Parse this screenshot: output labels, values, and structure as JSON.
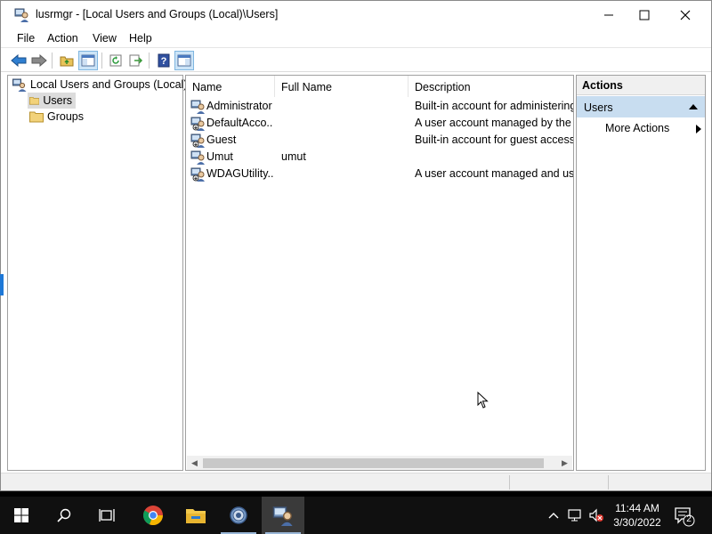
{
  "window": {
    "title": "lusrmgr - [Local Users and Groups (Local)\\Users]",
    "controls": {
      "minimize": "minimize",
      "maximize": "maximize",
      "close": "close"
    }
  },
  "menu": {
    "file": "File",
    "action": "Action",
    "view": "View",
    "help": "Help"
  },
  "toolbar": {
    "buttons": [
      "back-icon",
      "forward-icon",
      "up-folder-icon",
      "show-hide-tree-icon",
      "refresh-icon",
      "export-list-icon",
      "help-icon",
      "show-hide-action-pane-icon"
    ]
  },
  "tree": {
    "root": "Local Users and Groups (Local)",
    "users": "Users",
    "groups": "Groups"
  },
  "list": {
    "headers": {
      "name": "Name",
      "full_name": "Full Name",
      "description": "Description"
    },
    "rows": [
      {
        "name": "Administrator",
        "full_name": "",
        "description": "Built-in account for administering"
      },
      {
        "name": "DefaultAcco...",
        "full_name": "",
        "description": "A user account managed by the s"
      },
      {
        "name": "Guest",
        "full_name": "",
        "description": "Built-in account for guest access t"
      },
      {
        "name": "Umut",
        "full_name": "umut",
        "description": ""
      },
      {
        "name": "WDAGUtility...",
        "full_name": "",
        "description": "A user account managed and use"
      }
    ]
  },
  "actions": {
    "header": "Actions",
    "group": "Users",
    "more": "More Actions"
  },
  "taskbar": {
    "apps": [
      "start-icon",
      "search-icon",
      "task-view-icon",
      "chrome-icon",
      "file-explorer-icon",
      "settings-icon",
      "lusrmgr-icon"
    ],
    "time": "11:44 AM",
    "date": "3/30/2022",
    "notification_count": "2"
  },
  "colors": {
    "selection_blue": "#c8ddf0",
    "taskbar": "#101010",
    "accent": "#1e78d7"
  }
}
